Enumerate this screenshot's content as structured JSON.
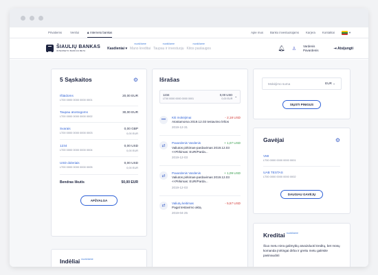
{
  "topnav": {
    "left": [
      "Privatiems",
      "Verslui",
      "Interneto bankas"
    ],
    "right": [
      "Apie mus",
      "Banko investuotojams",
      "Karjera",
      "Kontaktai"
    ]
  },
  "logo": {
    "name": "ŠIAULIŲ BANKAS",
    "sub": "INTERNETO BANKAS BETA"
  },
  "menu": [
    {
      "label": "Kasdieniai",
      "badge": ""
    },
    {
      "label": "Mano kreditai",
      "badge": "nuoščiame"
    },
    {
      "label": "Taupau ir investuoju",
      "badge": "nuoščiame"
    },
    {
      "label": "Kitos paslaugos",
      "badge": "nuoščiame"
    }
  ],
  "user": {
    "first": "Vardenis",
    "last": "Pavardenis",
    "logout": "Atsijungti"
  },
  "accounts": {
    "title": "5 Sąskaitos",
    "items": [
      {
        "name": "Išlaidoms",
        "iban": "LT00 0000 0000 0000 0001",
        "amt1": "20,00 EUR",
        "amt2": ""
      },
      {
        "name": "Taupau atostogoms",
        "iban": "LT00 0000 0000 0000 0002",
        "amt1": "30,00 EUR",
        "amt2": ""
      },
      {
        "name": "Svarais",
        "iban": "LT00 0000 0000 0000 0003",
        "amt1": "0,00 GBP",
        "amt2": "0,00 EUR"
      },
      {
        "name": "1234",
        "iban": "LT00 0000 0000 0000 0004",
        "amt1": "0,00 USD",
        "amt2": "0,00 EUR"
      },
      {
        "name": "USD doleriais",
        "iban": "LT00 0000 0000 0000 0005",
        "amt1": "0,00 USD",
        "amt2": "0,00 EUR"
      }
    ],
    "total_label": "Bendras likutis",
    "total_value": "50,00 EUR",
    "button": "APŽVALGA"
  },
  "deposits": {
    "title": "Indėliai",
    "badge": "nuoščiame"
  },
  "statement": {
    "title": "Išrašas",
    "select": {
      "name": "1234",
      "iban": "LT00 0000 0000 0000 0001",
      "amt1": "0,00 USD",
      "amt2": "0,00 EUR"
    },
    "items": [
      {
        "icon": "•••",
        "name": "Kiti mokėjimai",
        "amount": "- 2,18 USD",
        "sign": "neg",
        "desc": "Atostamoma 2019.12.03 testavimo lėšos",
        "date": "2019-12-31"
      },
      {
        "icon": "⇄",
        "name": "Pavardenis Vardenis",
        "amount": "+ 1,07 USD",
        "sign": "pos",
        "desc": "Valiutos pirkimas-pardavimas 2019.12.03 <<Pirkimas: EUR/Parda...",
        "date": "2019-12-03"
      },
      {
        "icon": "⇄",
        "name": "Pavardenis Vardenis",
        "amount": "+ 1,09 USD",
        "sign": "pos",
        "desc": "Valiutos pirkimas-pardavimas 2019.12.03 <<Pirkimas: EUR/Parda...",
        "date": "2019-12-03"
      },
      {
        "icon": "⇄",
        "name": "Valiutų keitimas",
        "amount": "- 5,57 USD",
        "sign": "neg",
        "desc": "Pagal testavimo aktą",
        "date": "2019-04-25"
      }
    ]
  },
  "payment": {
    "placeholder": "Mokėjimo suma",
    "currency": "EUR",
    "button": "SIŲSTI PINIGUS"
  },
  "payees": {
    "title": "Gavėjai",
    "items": [
      {
        "name": "VMI",
        "iban": "LT00 0000 0000 0000 0001"
      },
      {
        "name": "UAB TESTAS",
        "iban": "LT00 0000 0000 0000 0002"
      }
    ],
    "button": "DAUGIAU GAVĖJŲ"
  },
  "credits": {
    "title": "Kreditai",
    "badge": "nuoščiame",
    "text": "Šiuo metu nėra galimybių atvaizduoti kreditų, bet mūsų komanda įnirtingai dirba ir greitu metu galėsite pasinaudoti"
  }
}
